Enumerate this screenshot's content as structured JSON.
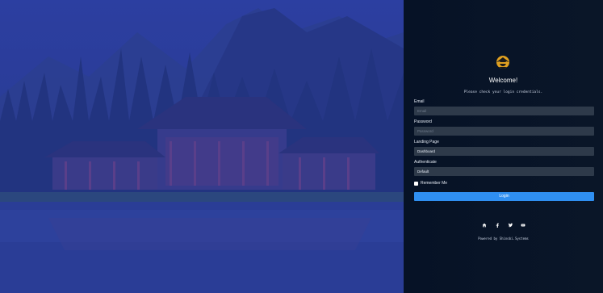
{
  "login": {
    "welcome": "Welcome!",
    "subtitle": "Please check your login credentials.",
    "email_label": "Email",
    "email_placeholder": "Email",
    "password_label": "Password",
    "password_placeholder": "Password",
    "landing_label": "Landing Page",
    "landing_value": "Dashboard",
    "auth_label": "Authenticate",
    "auth_value": "Default",
    "remember_label": "Remember Me",
    "login_button": "Login",
    "powered_by": "Powered by Shinobi.Systems"
  },
  "social_icons": [
    "home-icon",
    "facebook-icon",
    "twitter-icon",
    "youtube-icon"
  ],
  "colors": {
    "panel_bg": "#0a1628",
    "field_bg": "#2e3a4a",
    "button": "#2f8ff1",
    "photo_tint": "#2a3b8f"
  }
}
